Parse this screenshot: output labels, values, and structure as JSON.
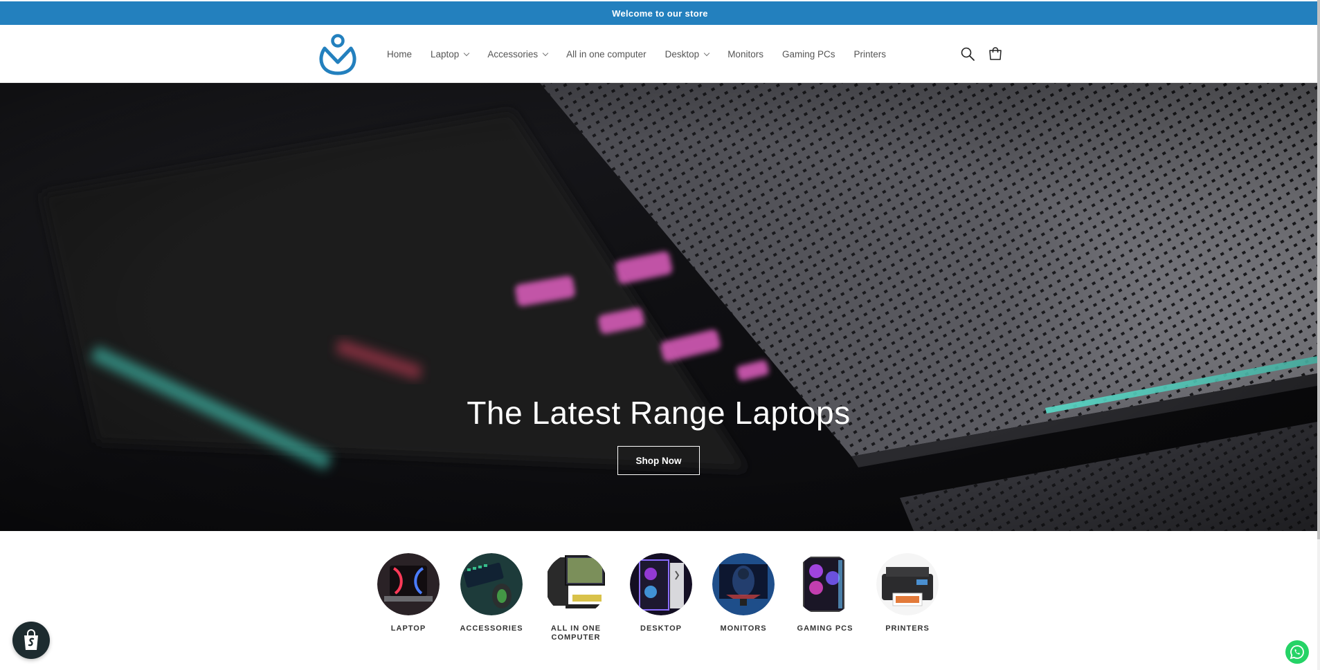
{
  "announcement": {
    "text": "Welcome to our store"
  },
  "nav": {
    "items": [
      {
        "label": "Home",
        "dropdown": false
      },
      {
        "label": "Laptop",
        "dropdown": true
      },
      {
        "label": "Accessories",
        "dropdown": true
      },
      {
        "label": "All in one computer",
        "dropdown": false
      },
      {
        "label": "Desktop",
        "dropdown": true
      },
      {
        "label": "Monitors",
        "dropdown": false
      },
      {
        "label": "Gaming PCs",
        "dropdown": false
      },
      {
        "label": "Printers",
        "dropdown": false
      }
    ]
  },
  "header_icons": {
    "search": "search-icon",
    "cart": "cart-icon"
  },
  "hero": {
    "title": "The Latest Range Laptops",
    "button": "Shop Now"
  },
  "categories": [
    {
      "label": "LAPTOP"
    },
    {
      "label": "ACCESSORIES"
    },
    {
      "label": "ALL IN ONE COMPUTER"
    },
    {
      "label": "DESKTOP"
    },
    {
      "label": "MONITORS"
    },
    {
      "label": "GAMING PCS"
    },
    {
      "label": "PRINTERS"
    }
  ],
  "colors": {
    "brand": "#2380be",
    "whatsapp": "#25d366",
    "shopify_badge": "#1d2b2f"
  }
}
